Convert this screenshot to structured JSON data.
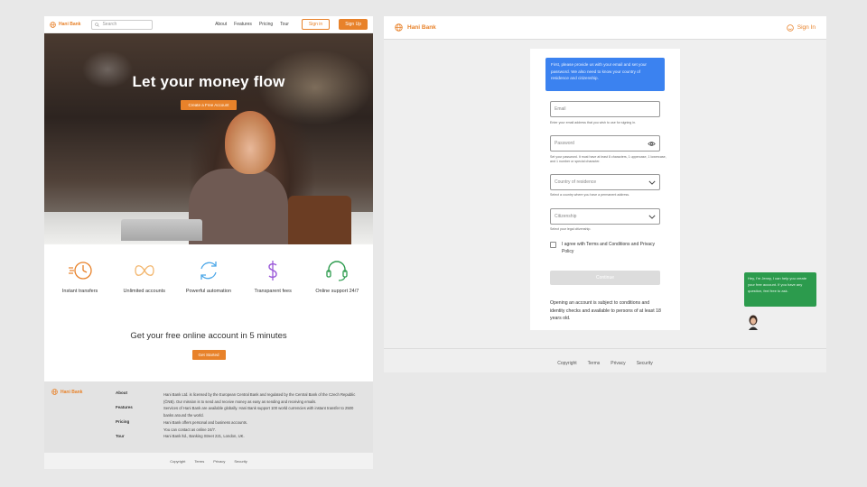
{
  "brand": {
    "name": "Hani Bank",
    "accent": "#e8822a",
    "blue": "#3b82f0",
    "green": "#2c9b4d"
  },
  "left": {
    "nav": {
      "search_placeholder": "Search",
      "links": [
        "About",
        "Features",
        "Pricing",
        "Tour"
      ],
      "signin": "Sign in",
      "signup": "Sign Up"
    },
    "hero": {
      "title": "Let your money flow",
      "cta": "Create a Free Account"
    },
    "features": [
      {
        "icon": "fast-clock-icon",
        "label": "Instant transfers"
      },
      {
        "icon": "infinity-icon",
        "label": "Unlimited accounts"
      },
      {
        "icon": "refresh-icon",
        "label": "Powerful automation"
      },
      {
        "icon": "dollar-icon",
        "label": "Transparent fees"
      },
      {
        "icon": "headset-icon",
        "label": "Online support 24/7"
      }
    ],
    "getstarted": {
      "title": "Get your free online account in 5 minutes",
      "button": "Get Started"
    },
    "footer": {
      "links": [
        "About",
        "Features",
        "Pricing",
        "Tour"
      ],
      "text": [
        "Hani Bank Ltd. is licensed by the European Central Bank and regulated by the Central Bank of the Czech Republic (ČNB). Our mission is to send and receive money as easy as sending and receiving emails.",
        "Services of Hani Bank are available globally. Hani Bank support 100 world currencies with instant transfer to 2500 banks around the world.",
        "Hani Bank offers personal and business accounts.",
        "You can contact as online 24/7.",
        "Hani Bank ltd., Banking Street 221, London, UK."
      ],
      "bottom": [
        "Copyright",
        "Terms",
        "Privacy",
        "Security"
      ]
    }
  },
  "right": {
    "signin": "Sign In",
    "info": "First, please provide us with your email and set your password. We also need to know your country of residence and citizenship.",
    "email": {
      "placeholder": "Email",
      "hint": "Enter your email address that you wish to use for signing in."
    },
    "password": {
      "placeholder": "Password",
      "hint": "Set your password. It must have at least 8 characters, 1 uppercase, 1 lowercase, and 1 number or special character."
    },
    "country": {
      "placeholder": "Country of residence",
      "hint": "Select a country where you have a permanent address."
    },
    "citizenship": {
      "placeholder": "Citizenship",
      "hint": "Select your legal citizenship."
    },
    "agree": "I agree with Terms and Conditions and Privacy Policy",
    "continue": "Continue",
    "note": "Opening an account is subject to conditions and identity checks and available to persons of at least 18 years old.",
    "chat": "Hey, I'm Jenny, I can help you create your free account. If you have any question, feel free to ask.",
    "footer": [
      "Copyright",
      "Terms",
      "Privacy",
      "Security"
    ]
  }
}
